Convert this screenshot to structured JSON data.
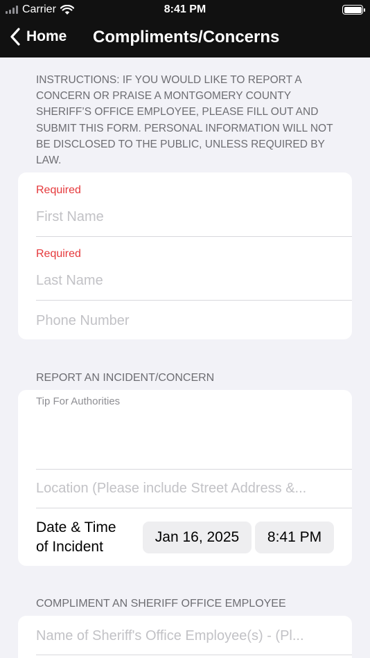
{
  "status_bar": {
    "carrier": "Carrier",
    "time": "8:41 PM"
  },
  "nav": {
    "back_label": "Home",
    "title": "Compliments/Concerns"
  },
  "instructions": "INSTRUCTIONS: IF YOU WOULD LIKE TO REPORT A CONCERN OR PRAISE A MONTGOMERY COUNTY SHERIFF’S OFFICE EMPLOYEE, PLEASE FILL OUT AND SUBMIT THIS FORM. PERSONAL INFORMATION WILL NOT BE DISCLOSED TO THE PUBLIC, UNLESS REQUIRED BY LAW.",
  "personal": {
    "first_name": {
      "required_label": "Required",
      "placeholder": "First Name"
    },
    "last_name": {
      "required_label": "Required",
      "placeholder": "Last Name"
    },
    "phone": {
      "placeholder": "Phone Number"
    }
  },
  "incident": {
    "header": "REPORT AN INCIDENT/CONCERN",
    "tip_label": "Tip For Authorities",
    "location_placeholder": "Location (Please include Street Address &...",
    "datetime_label_line1": "Date & Time",
    "datetime_label_line2": "of Incident",
    "date_value": "Jan 16, 2025",
    "time_value": "8:41 PM"
  },
  "compliment": {
    "header": "COMPLIMENT AN SHERIFF OFFICE EMPLOYEE",
    "employee_placeholder": "Name of Sheriff's Office Employee(s) - (Pl..."
  },
  "icons": {
    "back": "chevron-left-icon",
    "signal": "cell-signal-icon",
    "wifi": "wifi-icon",
    "battery": "battery-icon"
  },
  "colors": {
    "bar_bg": "#111111",
    "page_bg": "#f2f2f7",
    "required": "#e5383b",
    "placeholder": "#c2c2c6"
  }
}
